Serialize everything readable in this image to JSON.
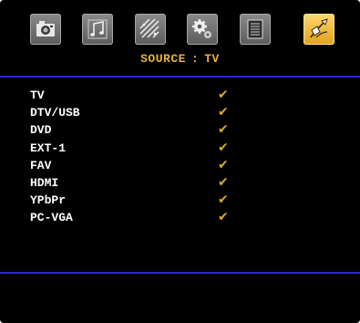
{
  "menu": {
    "tabs": [
      {
        "icon": "camera-icon",
        "active": false
      },
      {
        "icon": "music-note-icon",
        "active": false
      },
      {
        "icon": "picture-lines-icon",
        "active": false
      },
      {
        "icon": "gears-icon",
        "active": false
      },
      {
        "icon": "document-icon",
        "active": false
      },
      {
        "icon": "source-plug-icon",
        "active": true
      }
    ]
  },
  "header": {
    "label": "SOURCE",
    "separator": ":",
    "value": "TV"
  },
  "sources": [
    {
      "name": "TV",
      "enabled": true
    },
    {
      "name": "DTV/USB",
      "enabled": true
    },
    {
      "name": "DVD",
      "enabled": true
    },
    {
      "name": "EXT-1",
      "enabled": true
    },
    {
      "name": "FAV",
      "enabled": true
    },
    {
      "name": "HDMI",
      "enabled": true
    },
    {
      "name": "YPbPr",
      "enabled": true
    },
    {
      "name": "PC-VGA",
      "enabled": true
    }
  ],
  "check_mark": "✔",
  "colors": {
    "accent": "#e7b13a",
    "divider": "#2a2ac8",
    "background": "#000000",
    "text": "#ffffff"
  }
}
